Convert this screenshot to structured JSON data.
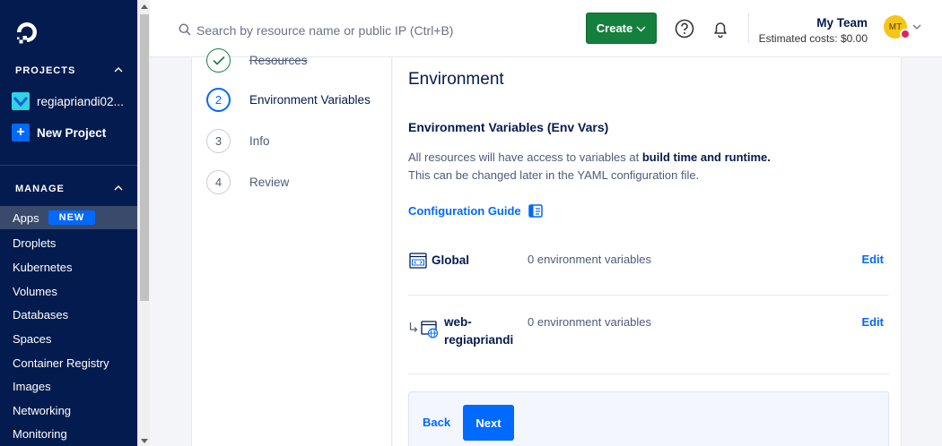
{
  "sidebar": {
    "projects_title": "PROJECTS",
    "project_name": "regiapriandi02...",
    "new_project": "New Project",
    "manage_title": "MANAGE",
    "items": [
      {
        "label": "Apps",
        "badge": "NEW",
        "active": true
      },
      {
        "label": "Droplets"
      },
      {
        "label": "Kubernetes"
      },
      {
        "label": "Volumes"
      },
      {
        "label": "Databases"
      },
      {
        "label": "Spaces"
      },
      {
        "label": "Container Registry"
      },
      {
        "label": "Images"
      },
      {
        "label": "Networking"
      },
      {
        "label": "Monitoring"
      }
    ]
  },
  "topbar": {
    "search_placeholder": "Search by resource name or public IP (Ctrl+B)",
    "create_label": "Create",
    "team_name": "My Team",
    "estimated_costs": "Estimated costs: $0.00",
    "avatar_initials": "MT"
  },
  "steps": [
    {
      "number": "",
      "label": "Resources",
      "state": "done"
    },
    {
      "number": "2",
      "label": "Environment Variables",
      "state": "active"
    },
    {
      "number": "3",
      "label": "Info",
      "state": "pending"
    },
    {
      "number": "4",
      "label": "Review",
      "state": "pending"
    }
  ],
  "content": {
    "title": "Environment",
    "subtitle": "Environment Variables (Env Vars)",
    "desc_line1_prefix": "All resources will have access to variables at ",
    "desc_line1_bold": "build time and runtime.",
    "desc_line2": "This can be changed later in the YAML configuration file.",
    "config_guide": "Configuration Guide",
    "components": [
      {
        "name": "Global",
        "vars": "0 environment variables",
        "edit": "Edit"
      },
      {
        "name_line1": "web-",
        "name_line2": "regiapriandi",
        "vars": "0 environment variables",
        "edit": "Edit"
      }
    ],
    "back_label": "Back",
    "next_label": "Next"
  },
  "colors": {
    "sidebar_bg": "#031b4e",
    "accent": "#0069ff",
    "create_green": "#15803d"
  }
}
